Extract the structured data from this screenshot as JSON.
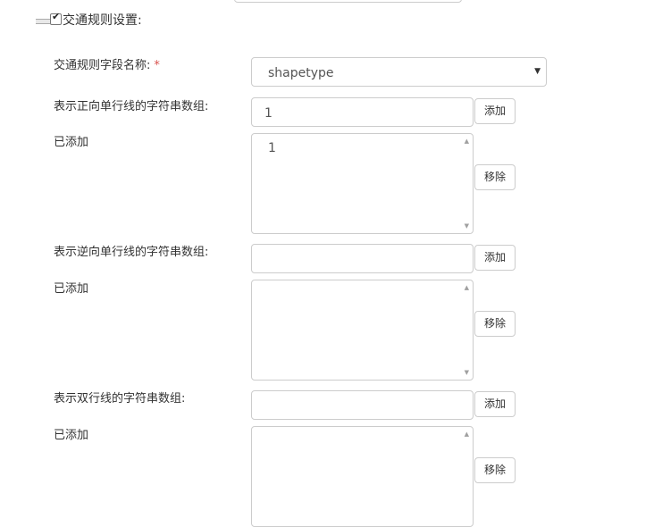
{
  "section": {
    "title": "交通规则设置:",
    "checked": true
  },
  "fields": {
    "name_label": "交通规则字段名称:",
    "required_mark": "*",
    "select_value": "shapetype",
    "forward_label": "表示正向单行线的字符串数组:",
    "forward_input": "1",
    "forward_added_label": "已添加",
    "forward_list": [
      "1"
    ],
    "reverse_label": "表示逆向单行线的字符串数组:",
    "reverse_input": "",
    "reverse_added_label": "已添加",
    "reverse_list": [],
    "double_label": "表示双行线的字符串数组:",
    "double_input": "",
    "double_added_label": "已添加",
    "double_list": []
  },
  "buttons": {
    "add": "添加",
    "remove": "移除"
  },
  "icons": {
    "select_caret": "▼",
    "scroll_up": "▲",
    "scroll_down": "▼",
    "checkmark": "✔"
  },
  "colors": {
    "border": "#cccccc",
    "required": "#d9534f",
    "text": "#333333"
  }
}
